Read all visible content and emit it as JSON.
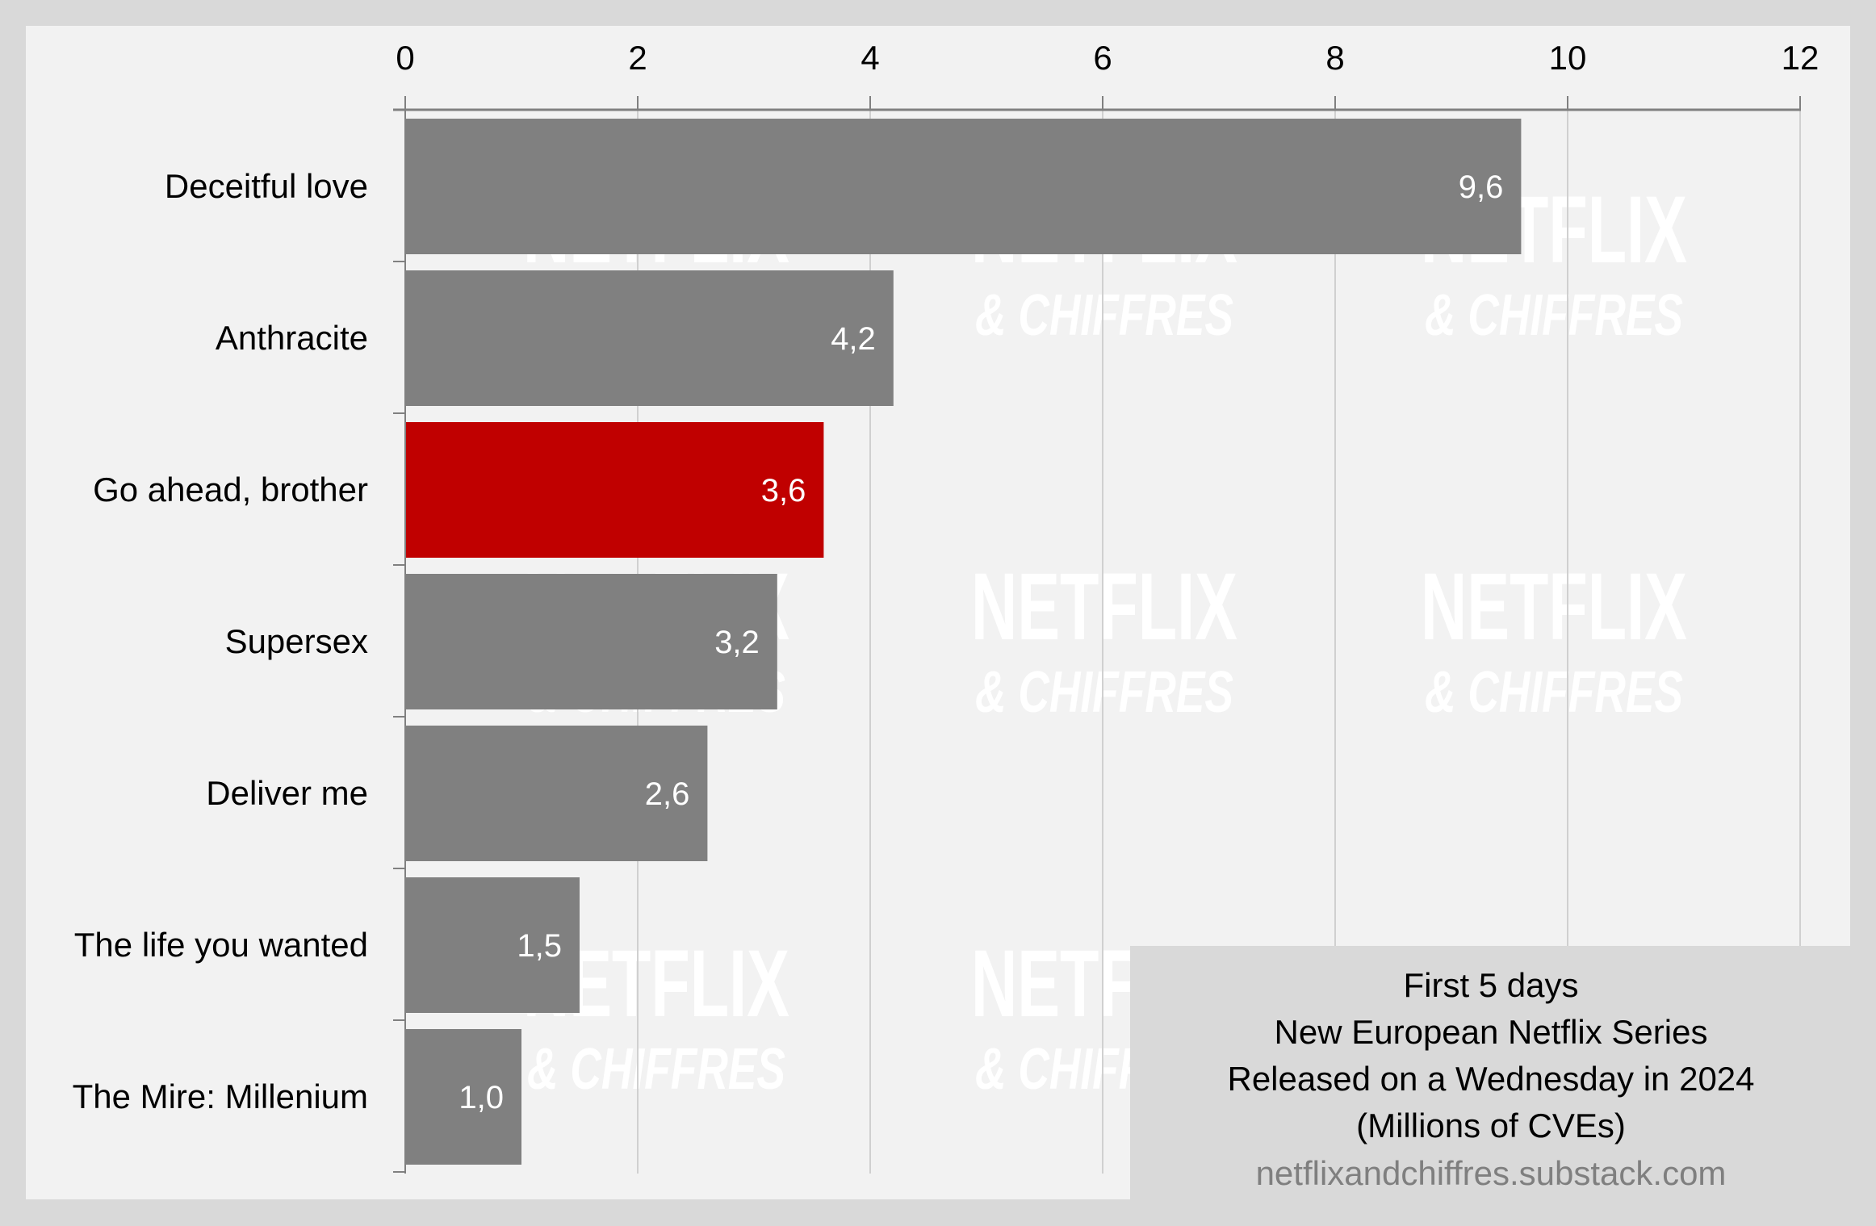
{
  "chart_data": {
    "type": "bar",
    "orientation": "horizontal",
    "categories": [
      "Deceitful love",
      "Anthracite",
      "Go ahead, brother",
      "Supersex",
      "Deliver me",
      "The life you wanted",
      "The Mire: Millenium"
    ],
    "values": [
      9.6,
      4.2,
      3.6,
      3.2,
      2.6,
      1.5,
      1.0
    ],
    "value_labels": [
      "9,6",
      "4,2",
      "3,6",
      "3,2",
      "2,6",
      "1,5",
      "1,0"
    ],
    "highlight_index": 2,
    "colors": {
      "default": "#808080",
      "highlight": "#c00000"
    },
    "xlim": [
      0,
      12
    ],
    "x_ticks": [
      0,
      2,
      4,
      6,
      8,
      10,
      12
    ],
    "x_tick_labels": [
      "0",
      "2",
      "4",
      "6",
      "8",
      "10",
      "12"
    ],
    "x_axis_position": "top",
    "grid": true,
    "title": "First 5 days New European Netflix Series Released on a Wednesday in 2024",
    "xlabel": "Millions of CVEs",
    "ylabel": ""
  },
  "caption": {
    "lines": [
      "First 5 days",
      "New European Netflix Series",
      "Released on a Wednesday in 2024",
      "(Millions of CVEs)"
    ],
    "source": "netflixandchiffres.substack.com"
  },
  "watermark": {
    "line1": "NETFLIX",
    "line2": "& CHIFFRES"
  }
}
